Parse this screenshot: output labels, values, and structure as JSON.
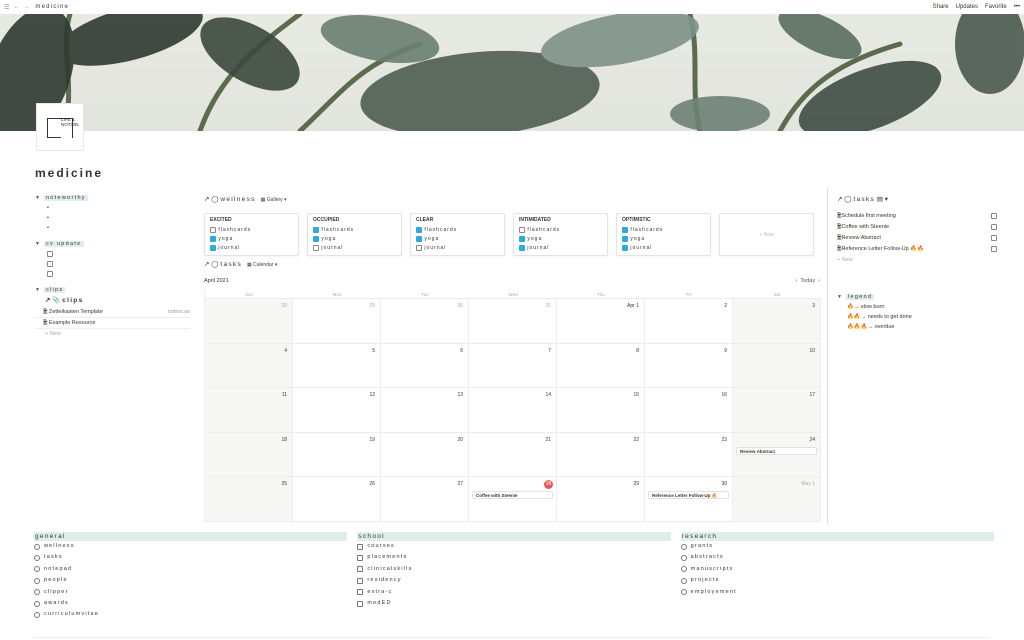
{
  "topbar": {
    "breadcrumb": "medicine",
    "share": "Share",
    "updates": "Updates",
    "favorite": "Favorite",
    "more": "•••"
  },
  "logo": {
    "text": "LIFE & NOTION"
  },
  "page": {
    "title": "medicine"
  },
  "left": {
    "noteworthy": "noteworthy",
    "cvupdate": "cv update",
    "clips": "clips",
    "clips_db": "clips",
    "clip_items": [
      {
        "title": "Zettelkasten Template",
        "url": "notion.so"
      },
      {
        "title": "Example Resource",
        "url": ""
      }
    ],
    "new": "New"
  },
  "wellness": {
    "title": "wellness",
    "view": "Gallery",
    "cards": [
      {
        "mood": "EXCITED",
        "items": [
          {
            "t": "flashcards",
            "c": false
          },
          {
            "t": "yoga",
            "c": true
          },
          {
            "t": "journal",
            "c": true
          }
        ]
      },
      {
        "mood": "OCCUPIED",
        "items": [
          {
            "t": "flashcards",
            "c": true
          },
          {
            "t": "yoga",
            "c": true
          },
          {
            "t": "journal",
            "c": false
          }
        ]
      },
      {
        "mood": "CLEAR",
        "items": [
          {
            "t": "flashcards",
            "c": true
          },
          {
            "t": "yoga",
            "c": true
          },
          {
            "t": "journal",
            "c": false
          }
        ]
      },
      {
        "mood": "INTIMIDATED",
        "items": [
          {
            "t": "flashcards",
            "c": false
          },
          {
            "t": "yoga",
            "c": true
          },
          {
            "t": "journal",
            "c": true
          }
        ]
      },
      {
        "mood": "OPTIMISTIC",
        "items": [
          {
            "t": "flashcards",
            "c": true
          },
          {
            "t": "yoga",
            "c": true
          },
          {
            "t": "journal",
            "c": true
          }
        ]
      }
    ],
    "new": "+ New"
  },
  "tasks_cal": {
    "title": "tasks",
    "view": "Calendar",
    "month": "April 2021",
    "today": "Today",
    "days": [
      "Sun",
      "Mon",
      "Tue",
      "Wed",
      "Thu",
      "Fri",
      "Sat"
    ],
    "weeks": [
      [
        "28",
        "29",
        "30",
        "31",
        "Apr 1",
        "2",
        "3"
      ],
      [
        "4",
        "5",
        "6",
        "7",
        "8",
        "9",
        "10"
      ],
      [
        "11",
        "12",
        "13",
        "14",
        "15",
        "16",
        "17"
      ],
      [
        "18",
        "19",
        "20",
        "21",
        "22",
        "23",
        "24"
      ],
      [
        "25",
        "26",
        "27",
        "28",
        "29",
        "30",
        "May 1"
      ]
    ],
    "events": [
      {
        "w": 3,
        "d": 6,
        "t": "Review Abstract"
      },
      {
        "w": 4,
        "d": 3,
        "t": "Coffee with Steenie"
      },
      {
        "w": 4,
        "d": 5,
        "t": "Reference Letter Follow-Up 🔥"
      }
    ],
    "today_cell": "28"
  },
  "right": {
    "title": "tasks",
    "items": [
      "Schedule first meeting",
      "Coffee with Steenie",
      "Review Abstract",
      "Reference Letter Follow-Up 🔥🔥"
    ],
    "new": "New",
    "legend_title": "legend",
    "legend": [
      "🔥→ slow burn",
      "🔥🔥→ needs to get done",
      "🔥🔥🔥→ overdue"
    ]
  },
  "bottom": {
    "general": {
      "title": "general",
      "items": [
        "wellness",
        "tasks",
        "notepad",
        "people",
        "clipper",
        "awards",
        "curriculumvitae"
      ]
    },
    "school": {
      "title": "school",
      "items": [
        "courses",
        "placements",
        "clinicalskills",
        "residency",
        "extra-c",
        "medED"
      ]
    },
    "research": {
      "title": "research",
      "items": [
        "grants",
        "abstracts",
        "manuscripts",
        "projects",
        "employement"
      ]
    }
  }
}
